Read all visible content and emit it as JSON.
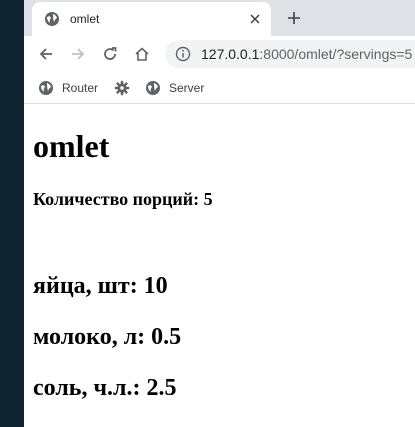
{
  "browser": {
    "tab": {
      "title": "omlet"
    },
    "omnibox": {
      "host": "127.0.0.1",
      "rest": ":8000/omlet/?servings=5"
    },
    "bookmarks": [
      {
        "label": "Router",
        "icon": "globe-icon"
      },
      {
        "label": "",
        "icon": "gear-icon"
      },
      {
        "label": "Server",
        "icon": "globe-icon"
      }
    ]
  },
  "page": {
    "title": "omlet",
    "servings_label": "Количество порций: 5",
    "ingredients": [
      "яйца, шт: 10",
      "молоко, л: 0.5",
      "соль, ч.л.: 2.5"
    ]
  }
}
